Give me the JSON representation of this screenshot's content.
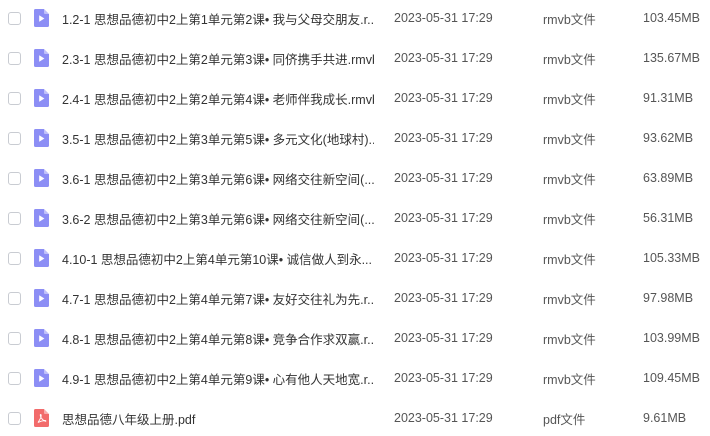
{
  "colors": {
    "video_icon": "#8c8ef5",
    "pdf_icon": "#f26b6b",
    "text": "#333333",
    "meta_text": "#555555"
  },
  "files": [
    {
      "name": "1.2-1 思想品德初中2上第1单元第2课• 我与父母交朋友.r...",
      "date": "2023-05-31 17:29",
      "type": "rmvb文件",
      "size": "103.45MB",
      "icon": "video-file-icon"
    },
    {
      "name": "2.3-1 思想品德初中2上第2单元第3课• 同侪携手共进.rmvb",
      "date": "2023-05-31 17:29",
      "type": "rmvb文件",
      "size": "135.67MB",
      "icon": "video-file-icon"
    },
    {
      "name": "2.4-1 思想品德初中2上第2单元第4课• 老师伴我成长.rmvb",
      "date": "2023-05-31 17:29",
      "type": "rmvb文件",
      "size": "91.31MB",
      "icon": "video-file-icon"
    },
    {
      "name": "3.5-1 思想品德初中2上第3单元第5课• 多元文化(地球村)...",
      "date": "2023-05-31 17:29",
      "type": "rmvb文件",
      "size": "93.62MB",
      "icon": "video-file-icon"
    },
    {
      "name": "3.6-1 思想品德初中2上第3单元第6课• 网络交往新空间(...",
      "date": "2023-05-31 17:29",
      "type": "rmvb文件",
      "size": "63.89MB",
      "icon": "video-file-icon"
    },
    {
      "name": "3.6-2 思想品德初中2上第3单元第6课• 网络交往新空间(...",
      "date": "2023-05-31 17:29",
      "type": "rmvb文件",
      "size": "56.31MB",
      "icon": "video-file-icon"
    },
    {
      "name": "4.10-1 思想品德初中2上第4单元第10课• 诚信做人到永...",
      "date": "2023-05-31 17:29",
      "type": "rmvb文件",
      "size": "105.33MB",
      "icon": "video-file-icon"
    },
    {
      "name": "4.7-1 思想品德初中2上第4单元第7课• 友好交往礼为先.r...",
      "date": "2023-05-31 17:29",
      "type": "rmvb文件",
      "size": "97.98MB",
      "icon": "video-file-icon"
    },
    {
      "name": "4.8-1 思想品德初中2上第4单元第8课• 竞争合作求双赢.r...",
      "date": "2023-05-31 17:29",
      "type": "rmvb文件",
      "size": "103.99MB",
      "icon": "video-file-icon"
    },
    {
      "name": "4.9-1 思想品德初中2上第4单元第9课• 心有他人天地宽.r...",
      "date": "2023-05-31 17:29",
      "type": "rmvb文件",
      "size": "109.45MB",
      "icon": "video-file-icon"
    },
    {
      "name": "思想品德八年级上册.pdf",
      "date": "2023-05-31 17:29",
      "type": "pdf文件",
      "size": "9.61MB",
      "icon": "pdf-file-icon"
    }
  ]
}
